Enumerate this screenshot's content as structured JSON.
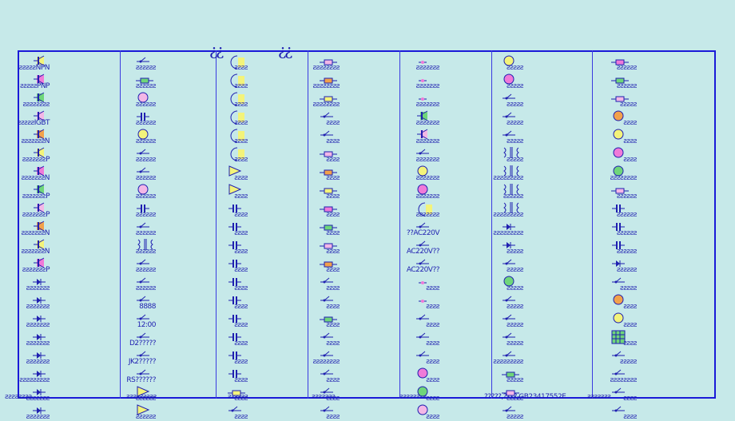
{
  "hooks": [
    "¿¿",
    "¿¿"
  ],
  "footer": [
    "ƨƨƨƨƨƨƨƨ",
    "ƨƨƨƨƨƨƨƨƨ",
    "ƨƨƨƨƨƨ",
    "ƨƨƨƨƨƨƨ",
    "ƨƨƨƨƨƨƨƨ",
    "?????,????,GB23417552E",
    "ƨƨƨƨƨƨƨ"
  ],
  "palette": {
    "frame": "#1a1ad8",
    "ink": "#1f1fb0",
    "yellow": "#f3f37a",
    "pink": "#f07ad8",
    "green": "#6fd67a",
    "orange": "#f2a14b",
    "lightpink": "#f3b7e6"
  },
  "columns": [
    {
      "labels": [
        "ƨƨƨƨƨNPN",
        "ƨƨƨƨƨPNP",
        "ƨƨƨƨƨƨƨƨ",
        "ƨƨƨƨƨIGBT",
        "ƨƨƨƨƨƨƨN",
        "ƨƨƨƨƨƨƨP",
        "ƨƨƨƨƨƨƨN",
        "ƨƨƨƨƨƨƨP",
        "ƨƨƨƨƨƨƨP",
        "ƨƨƨƨƨƨƨN",
        "ƨƨƨƨƨƨƨN",
        "ƨƨƨƨƨƨƨP",
        "ƨƨƨƨƨƨƨ",
        "ƨƨƨƨƨƨƨ",
        "ƨƨƨƨƨƨƨ",
        "ƨƨƨƨƨƨƨ",
        "ƨƨƨƨƨƨƨ",
        "ƨƨƨƨƨƨƨƨƨ",
        "ƨƨƨƨƨƨƨ",
        "ƨƨƨƨƨƨƨ"
      ],
      "icons": [
        "npn-transistor-icon",
        "pnp-transistor-icon",
        "transistor-icon",
        "igbt-icon",
        "nmos-icon",
        "pmos-icon",
        "nmos-icon",
        "pmos-icon",
        "pmos-icon",
        "nmos-icon",
        "nmos-icon",
        "pmos-icon",
        "diode-icon",
        "diode-icon",
        "diode-icon",
        "zener-icon",
        "diode-icon",
        "led-icon",
        "diode-icon",
        "diode-icon"
      ]
    },
    {
      "labels": [
        "ƨƨƨƨƨƨ",
        "ƨƨƨƨƨƨ",
        "ƨƨƨƨƨƨ",
        "ƨƨƨƨƨƨ",
        "ƨƨƨƨƨƨ",
        "ƨƨƨƨƨƨ",
        "ƨƨƨƨƨƨ",
        "ƨƨƨƨƨƨ",
        "ƨƨƨƨƨƨ",
        "ƨƨƨƨƨƨ",
        "ƨƨƨƨƨƨ",
        "ƨƨƨƨƨƨ",
        "ƨƨƨƨƨƨ",
        "8888",
        "12:00",
        "D2?????",
        "JK2?????",
        "RS??????",
        "ƨƨƨƨƨƨ",
        "ƨƨƨƨƨƨ"
      ],
      "icons": [
        "switch-icon",
        "crystal-icon",
        "motor-icon",
        "capacitor-icon",
        "lamp-icon",
        "relay-icon",
        "buzzer-icon",
        "speaker-icon",
        "capacitor-icon",
        "antenna-icon",
        "transformer-icon",
        "photo-icon",
        "display-icon",
        "seven-seg-icon",
        "clock-icon",
        "flipflop-icon",
        "flipflop-icon",
        "flipflop-icon",
        "amp-icon",
        "amp-icon"
      ]
    },
    {
      "labels": [
        "ƨƨƨƨ",
        "ƨƨƨƨ",
        "ƨƨƨƨ",
        "ƨƨƨƨ",
        "ƨƨƨƨ",
        "ƨƨƨƨ",
        "ƨƨƨƨ",
        "ƨƨƨƨ",
        "ƨƨƨƨ",
        "ƨƨƨƨ",
        "ƨƨƨƨ",
        "ƨƨƨƨ",
        "ƨƨƨƨ",
        "ƨƨƨƨ",
        "ƨƨƨƨ",
        "ƨƨƨƨ",
        "ƨƨƨƨ",
        "ƨƨƨƨ",
        "ƨƨƨƨ",
        "ƨƨƨƨ"
      ],
      "icons": [
        "inductor-icon",
        "inductor-icon",
        "coil-icon",
        "coil-icon",
        "coil-icon",
        "coil-icon",
        "opamp-icon",
        "opamp-icon",
        "battery-icon",
        "battery-icon",
        "battery-icon",
        "capacitor-icon",
        "capacitor-icon",
        "capacitor-icon",
        "capacitor-icon",
        "capacitor-icon",
        "capacitor-icon",
        "capacitor-icon",
        "fuse-icon",
        "ground-icon"
      ]
    },
    {
      "labels": [
        "ƨƨƨƨƨƨƨƨ",
        "ƨƨƨƨƨƨƨƨ",
        "ƨƨƨƨƨƨƨƨ",
        "ƨƨƨƨ",
        "ƨƨƨƨ",
        "ƨƨƨƨ",
        "ƨƨƨƨ",
        "ƨƨƨƨ",
        "ƨƨƨƨ",
        "ƨƨƨƨ",
        "ƨƨƨƨ",
        "ƨƨƨƨ",
        "ƨƨƨƨ",
        "ƨƨƨƨ",
        "ƨƨƨƨ",
        "ƨƨƨƨ",
        "ƨƨƨƨƨƨƨƨ",
        "ƨƨƨƨ",
        "ƨƨƨƨ",
        "ƨƨƨƨ"
      ],
      "icons": [
        "resistor-icon",
        "resistor-icon",
        "resistor-icon",
        "switch-icon",
        "switch-icon",
        "resistor-icon",
        "resistor-icon",
        "resistor-icon",
        "resistor-icon",
        "resistor-icon",
        "resistor-icon",
        "resistor-icon",
        "switch-icon",
        "switch-icon",
        "resistor-icon",
        "switch-icon",
        "switch-icon",
        "switch-icon",
        "switch-icon",
        "switch-icon"
      ]
    },
    {
      "labels": [
        "ƨƨƨƨƨƨƨ",
        "ƨƨƨƨƨƨƨ",
        "ƨƨƨƨƨƨƨ",
        "ƨƨƨƨƨƨƨ",
        "ƨƨƨƨƨƨƨ",
        "ƨƨƨƨƨƨƨ",
        "ƨƨƨƨƨƨƨ",
        "ƨƨƨƨƨƨƨ",
        "ƨƨƨƨƨƨƨ",
        "??AC220V",
        "AC220V??",
        "AC220V??",
        "ƨƨƨƨ",
        "ƨƨƨƨ",
        "ƨƨƨƨ",
        "ƨƨƨƨ",
        "ƨƨƨƨ",
        "ƨƨƨƨ",
        "ƨƨƨƨ",
        "ƨƨƨƨ"
      ],
      "icons": [
        "node-icon",
        "node-icon",
        "node-icon",
        "transistor-icon",
        "transistor-icon",
        "connector-icon",
        "meter-icon",
        "meter-icon",
        "coil-icon",
        "plug-icon",
        "plug-icon",
        "plug-icon",
        "dot-icon",
        "dot-icon",
        "line-icon",
        "line-icon",
        "antenna-icon",
        "lamp-icon",
        "lamp-icon",
        "lamp-icon"
      ]
    },
    {
      "labels": [
        "ƨƨƨƨƨ",
        "ƨƨƨƨƨ",
        "ƨƨƨƨƨ",
        "ƨƨƨƨƨ",
        "ƨƨƨƨƨ",
        "ƨƨƨƨƨ",
        "ƨƨƨƨƨƨƨƨƨ",
        "ƨƨƨƨƨƨ",
        "ƨƨƨƨƨƨƨƨƨ",
        "ƨƨƨƨƨƨƨƨƨ",
        "ƨƨƨƨƨ",
        "ƨƨƨƨƨ",
        "ƨƨƨƨƨ",
        "ƨƨƨƨƨ",
        "ƨƨƨƨƨ",
        "ƨƨƨƨƨ",
        "ƨƨƨƨƨƨƨƨƨ",
        "ƨƨƨƨƨ",
        "ƨƨƨƨƨ",
        "ƨƨƨƨƨ"
      ],
      "icons": [
        "speaker-icon",
        "meter-icon",
        "sensor-icon",
        "connector-icon",
        "connector-icon",
        "transformer-icon",
        "transformer-icon",
        "transformer-icon",
        "transformer-icon",
        "diode-icon",
        "diode-icon",
        "relay-icon",
        "meter-icon",
        "switch-icon",
        "switch-icon",
        "switch-icon",
        "switch-icon",
        "resistor-icon",
        "fuse-icon",
        "switch-icon"
      ]
    },
    {
      "labels": [
        "ƨƨƨƨƨƨ",
        "ƨƨƨƨƨƨ",
        "ƨƨƨƨƨ",
        "ƨƨƨƨ",
        "ƨƨƨƨ",
        "ƨƨƨƨ",
        "ƨƨƨƨƨƨƨƨ",
        "ƨƨƨƨƨƨ",
        "ƨƨƨƨƨƨ",
        "ƨƨƨƨƨƨ",
        "ƨƨƨƨƨƨ",
        "ƨƨƨƨƨƨ",
        "ƨƨƨƨƨ",
        "ƨƨƨƨ",
        "ƨƨƨƨ",
        "ƨƨƨƨ",
        "ƨƨƨƨƨ",
        "ƨƨƨƨƨƨƨƨ",
        "ƨƨƨƨ",
        "ƨƨƨƨ"
      ],
      "icons": [
        "fuse-icon",
        "resistor-icon",
        "resistor-icon",
        "lamp-icon",
        "lamp-icon",
        "lamp-icon",
        "lamp-icon",
        "resistor-icon",
        "capacitor-icon",
        "capacitor-icon",
        "capacitor-icon",
        "led-icon",
        "sensor-icon",
        "motor-icon",
        "motor-icon",
        "keypad-icon",
        "bar-icon",
        "switch-icon",
        "ground-icon",
        "ground-icon"
      ]
    }
  ]
}
